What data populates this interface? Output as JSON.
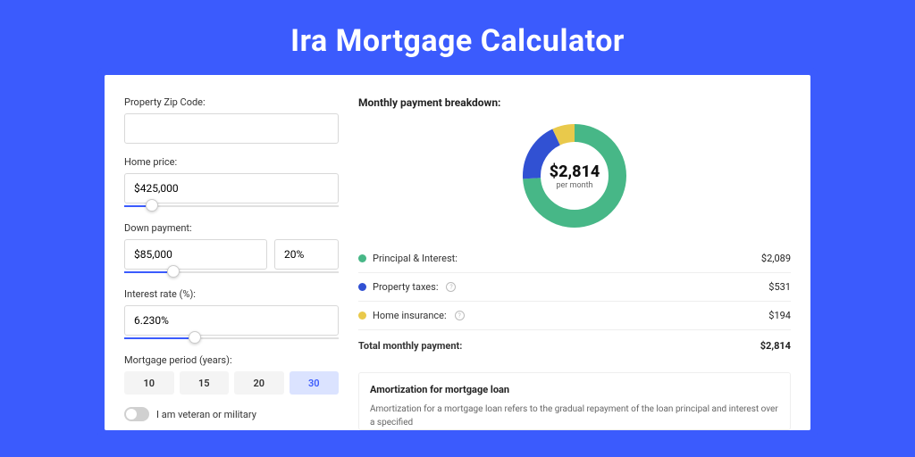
{
  "title": "Ira Mortgage Calculator",
  "form": {
    "zip_label": "Property Zip Code:",
    "zip_value": "",
    "home_price_label": "Home price:",
    "home_price_value": "$425,000",
    "down_payment_label": "Down payment:",
    "down_payment_value": "$85,000",
    "down_payment_pct": "20%",
    "interest_label": "Interest rate (%):",
    "interest_value": "6.230%",
    "period_label": "Mortgage period (years):",
    "periods": [
      "10",
      "15",
      "20",
      "30"
    ],
    "period_active": "30",
    "veteran_label": "I am veteran or military"
  },
  "breakdown": {
    "title": "Monthly payment breakdown:",
    "center_value": "$2,814",
    "center_sub": "per month",
    "rows": [
      {
        "label": "Principal & Interest:",
        "value": "$2,089",
        "color": "#47b787",
        "info": false
      },
      {
        "label": "Property taxes:",
        "value": "$531",
        "color": "#3151d3",
        "info": true
      },
      {
        "label": "Home insurance:",
        "value": "$194",
        "color": "#e9c94b",
        "info": true
      }
    ],
    "total_label": "Total monthly payment:",
    "total_value": "$2,814"
  },
  "amort": {
    "title": "Amortization for mortgage loan",
    "text": "Amortization for a mortgage loan refers to the gradual repayment of the loan principal and interest over a specified"
  },
  "sliders": {
    "home_price_pct": 10,
    "down_payment_pct": 20,
    "interest_pct": 30
  },
  "chart_data": {
    "type": "pie",
    "title": "Monthly payment breakdown",
    "categories": [
      "Principal & Interest",
      "Property taxes",
      "Home insurance"
    ],
    "values": [
      2089,
      531,
      194
    ],
    "colors": [
      "#47b787",
      "#3151d3",
      "#e9c94b"
    ],
    "total": 2814,
    "center_label": "$2,814 per month"
  }
}
